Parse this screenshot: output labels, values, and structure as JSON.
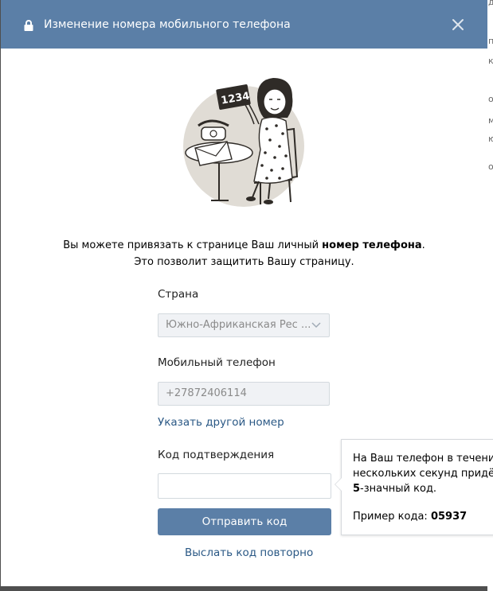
{
  "dialog": {
    "title": "Изменение номера мобильного телефона",
    "intro_part1": "Вы можете привязать к странице Ваш личный ",
    "intro_bold": "номер телефона",
    "intro_part2": ".",
    "intro_line2": "Это позволит защитить Вашу страницу.",
    "illustration_code": "1234"
  },
  "form": {
    "country_label": "Страна",
    "country_value": "Южно-Африканская Рес ...",
    "phone_label": "Мобильный телефон",
    "phone_value": "+27872406114",
    "change_number_link": "Указать другой номер",
    "code_label": "Код подтверждения",
    "code_value": "",
    "submit_label": "Отправить код",
    "resend_link": "Выслать код повторно"
  },
  "tooltip": {
    "line1": "На Ваш телефон в течение",
    "line2": "нескольких секунд придёт",
    "line3_bold": "5",
    "line3_rest": "-значный код.",
    "example_label": "Пример кода: ",
    "example_code": "05937"
  },
  "background_page": {
    "edge_chars": [
      "де",
      "п",
      "к",
      "о",
      "м",
      "ю",
      "о"
    ]
  },
  "colors": {
    "header": "#5b7fa7",
    "button": "#5b7fa7",
    "link": "#2a5885",
    "overlay": "#4f4f4f"
  },
  "icons": {
    "lock": "lock-icon",
    "close": "close-icon",
    "dropdown": "chevron-down-icon"
  }
}
